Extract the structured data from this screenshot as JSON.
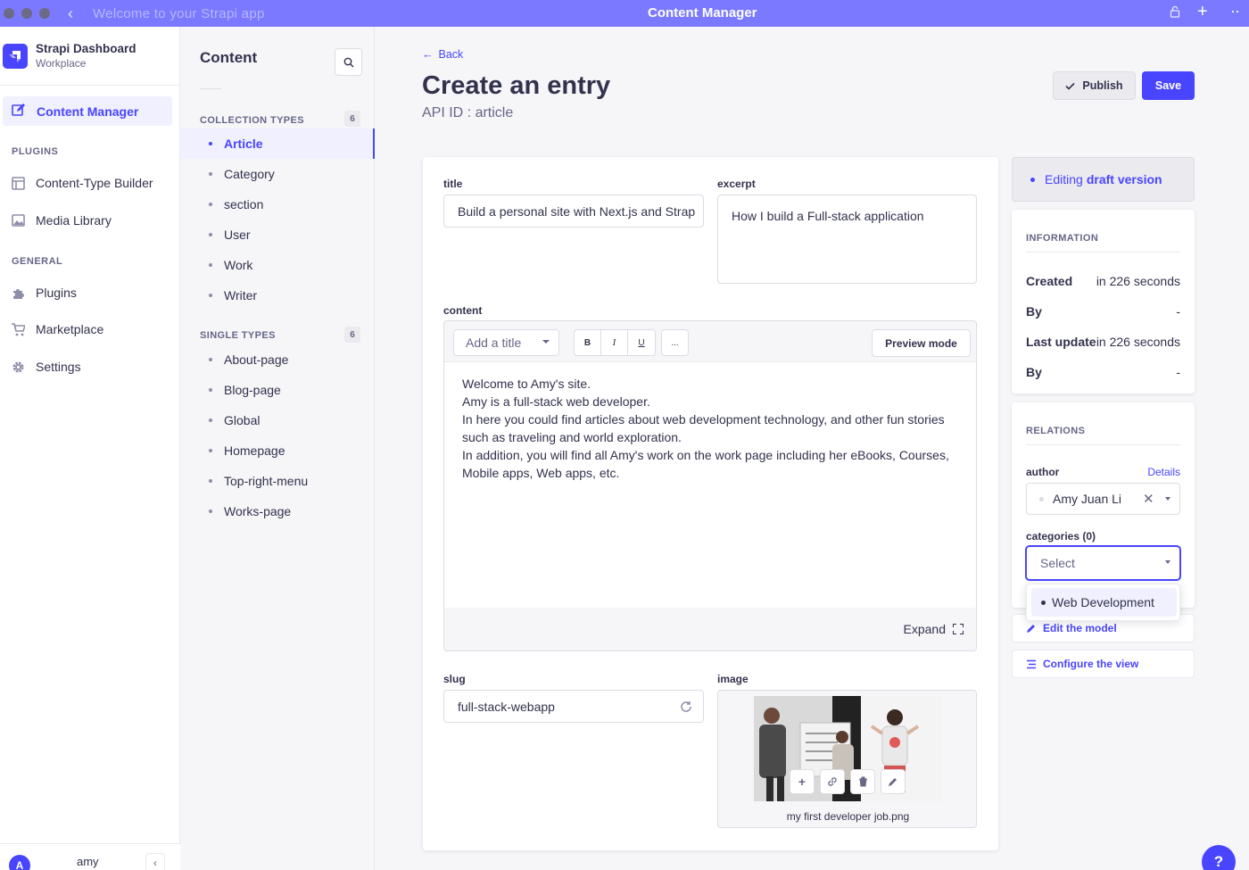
{
  "window": {
    "left_title": "Welcome to your Strapi app",
    "center_title": "Content Manager",
    "titlebar_color": "#7b79ff"
  },
  "brand": {
    "title": "Strapi Dashboard",
    "subtitle": "Workplace",
    "accent": "#4945ff"
  },
  "mainnav": {
    "active": "Content Manager",
    "plugins_heading": "PLUGINS",
    "plugins": [
      "Content-Type Builder",
      "Media Library"
    ],
    "general_heading": "GENERAL",
    "general": [
      "Plugins",
      "Marketplace",
      "Settings"
    ]
  },
  "user": {
    "initial": "A",
    "name": "amy"
  },
  "subnav": {
    "title": "Content",
    "collection_heading": "COLLECTION TYPES",
    "collection_count": "6",
    "collection_types": [
      "Article",
      "Category",
      "section",
      "User",
      "Work",
      "Writer"
    ],
    "single_heading": "SINGLE TYPES",
    "single_count": "6",
    "single_types": [
      "About-page",
      "Blog-page",
      "Global",
      "Homepage",
      "Top-right-menu",
      "Works-page"
    ]
  },
  "header": {
    "back": "Back",
    "title": "Create an entry",
    "api_id": "API ID : article",
    "publish": "Publish",
    "save": "Save"
  },
  "form": {
    "title_label": "title",
    "title_value": "Build a personal site with Next.js and Strap",
    "excerpt_label": "excerpt",
    "excerpt_value": "How I build a Full-stack application",
    "content_label": "content",
    "heading_select": "Add a title",
    "bold": "B",
    "italic": "I",
    "underline": "U",
    "more": "...",
    "preview_mode": "Preview mode",
    "content_lines": [
      "Welcome to Amy's site.",
      "Amy is a full-stack web developer.",
      "In here you could find articles about web development technology, and other fun stories such as traveling and world exploration.",
      "In addition, you will find all Amy's work on the work page including her eBooks, Courses, Mobile apps, Web apps, etc."
    ],
    "expand": "Expand",
    "slug_label": "slug",
    "slug_value": "full-stack-webapp",
    "image_label": "image",
    "image_name": "my first developer job.png"
  },
  "sidebar": {
    "editing_prefix": "Editing",
    "editing_version": "draft version",
    "information_heading": "INFORMATION",
    "info": [
      {
        "k": "Created",
        "v": "in 226 seconds"
      },
      {
        "k": "By",
        "v": "-"
      },
      {
        "k": "Last update",
        "v": "in 226 seconds"
      },
      {
        "k": "By",
        "v": "-"
      }
    ],
    "relations_heading": "RELATIONS",
    "author_label": "author",
    "author_details": "Details",
    "author_value": "Amy Juan Li",
    "categories_label": "categories (0)",
    "categories_placeholder": "Select",
    "categories_option": "Web Development",
    "edit_model": "Edit the model",
    "configure_view": "Configure the view"
  },
  "help": "?"
}
